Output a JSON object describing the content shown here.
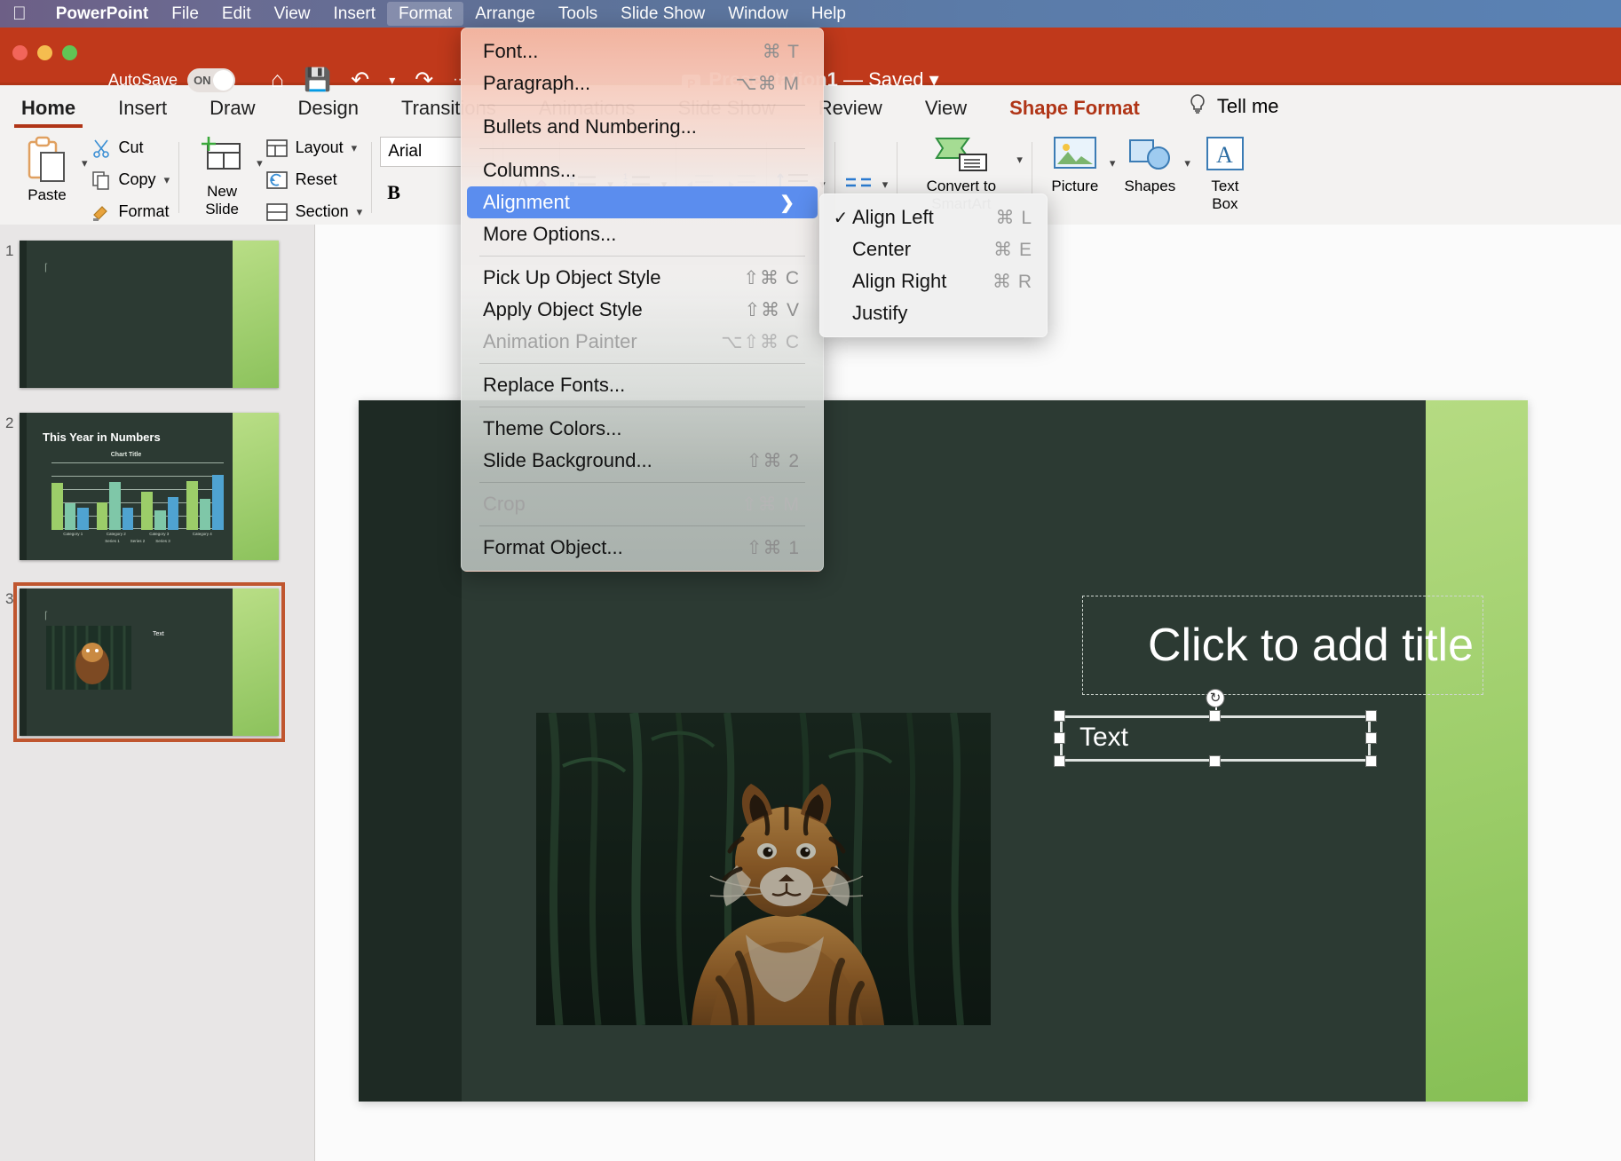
{
  "menubar": {
    "apple_icon": "apple-logo-icon",
    "app_name": "PowerPoint",
    "items": [
      "File",
      "Edit",
      "View",
      "Insert",
      "Format",
      "Arrange",
      "Tools",
      "Slide Show",
      "Window",
      "Help"
    ],
    "active_item": "Format"
  },
  "titlebar": {
    "autosave_label": "AutoSave",
    "autosave_state": "ON",
    "home_icon": "home-icon",
    "save_icon": "save-icon",
    "undo_icon": "undo-icon",
    "redo_icon": "redo-icon",
    "more_icon": "more-ellipsis-icon",
    "doc_title": "Presentation1",
    "doc_status": "— Saved",
    "badge": "P"
  },
  "ribbon": {
    "tabs": [
      {
        "label": "Home",
        "selected": true
      },
      {
        "label": "Insert",
        "selected": false
      },
      {
        "label": "Draw",
        "selected": false
      },
      {
        "label": "Design",
        "selected": false
      },
      {
        "label": "Transitions",
        "selected": false
      },
      {
        "label": "Animations",
        "selected": false
      },
      {
        "label": "Slide Show",
        "selected": false
      },
      {
        "label": "Review",
        "selected": false
      },
      {
        "label": "View",
        "selected": false
      }
    ],
    "context_tab": "Shape Format",
    "tell_me": "Tell me",
    "tell_me_icon": "lightbulb-icon",
    "clipboard": {
      "paste": "Paste",
      "cut": "Cut",
      "copy": "Copy",
      "format": "Format"
    },
    "slides": {
      "new_slide": "New\nSlide",
      "new_slide_line1": "New",
      "new_slide_line2": "Slide",
      "layout": "Layout",
      "reset": "Reset",
      "section": "Section"
    },
    "font": {
      "family": "Arial",
      "bold": "B"
    },
    "paragraph": {
      "text_effects_icon": "text-effects-icon",
      "bullets_icon": "bullets-icon",
      "numbering_icon": "numbering-icon",
      "decrease_indent_icon": "decrease-indent-icon",
      "increase_indent_icon": "increase-indent-icon",
      "line_spacing_icon": "line-spacing-icon",
      "align_left_icon": "align-left-icon",
      "align_center_icon": "align-center-icon",
      "align_right_icon": "align-right-icon",
      "justify_icon": "justify-icon",
      "text_direction_icon": "text-direction-icon",
      "align_text_icon": "align-text-icon",
      "columns_icon": "columns-icon"
    },
    "smartart": {
      "convert_line1": "Convert to",
      "convert_line2": "SmartArt"
    },
    "insert": {
      "picture": "Picture",
      "shapes": "Shapes",
      "textbox_line1": "Text",
      "textbox_line2": "Box"
    }
  },
  "format_menu": {
    "items": [
      {
        "label": "Font...",
        "shortcut": "⌘ T",
        "kind": "normal"
      },
      {
        "label": "Paragraph...",
        "shortcut": "⌥⌘ M",
        "kind": "normal"
      },
      {
        "kind": "separator"
      },
      {
        "label": "Bullets and Numbering...",
        "shortcut": "",
        "kind": "normal"
      },
      {
        "kind": "separator"
      },
      {
        "label": "Columns...",
        "shortcut": "",
        "kind": "normal"
      },
      {
        "label": "Alignment",
        "shortcut": "",
        "kind": "highlight",
        "arrow": "›"
      },
      {
        "label": "More Options...",
        "shortcut": "",
        "kind": "normal"
      },
      {
        "kind": "separator"
      },
      {
        "label": "Pick Up Object Style",
        "shortcut": "⇧⌘ C",
        "kind": "normal"
      },
      {
        "label": "Apply Object Style",
        "shortcut": "⇧⌘ V",
        "kind": "normal"
      },
      {
        "label": "Animation Painter",
        "shortcut": "⌥⇧⌘ C",
        "kind": "disabled"
      },
      {
        "kind": "separator"
      },
      {
        "label": "Replace Fonts...",
        "shortcut": "",
        "kind": "normal"
      },
      {
        "kind": "separator"
      },
      {
        "label": "Theme Colors...",
        "shortcut": "",
        "kind": "normal"
      },
      {
        "label": "Slide Background...",
        "shortcut": "⇧⌘ 2",
        "kind": "normal"
      },
      {
        "kind": "separator"
      },
      {
        "label": "Crop",
        "shortcut": "⇧⌘ M",
        "kind": "disabled"
      },
      {
        "kind": "separator"
      },
      {
        "label": "Format Object...",
        "shortcut": "⇧⌘ 1",
        "kind": "normal"
      }
    ]
  },
  "alignment_submenu": {
    "items": [
      {
        "label": "Align Left",
        "shortcut": "⌘ L",
        "checked": true
      },
      {
        "label": "Center",
        "shortcut": "⌘ E",
        "checked": false
      },
      {
        "label": "Align Right",
        "shortcut": "⌘ R",
        "checked": false
      },
      {
        "label": "Justify",
        "shortcut": "",
        "checked": false
      }
    ]
  },
  "thumbnails": [
    {
      "number": "1",
      "title": "",
      "selected": false
    },
    {
      "number": "2",
      "title": "This Year in Numbers",
      "chart_title": "Chart Title",
      "selected": false
    },
    {
      "number": "3",
      "title": "",
      "text_label": "Text",
      "selected": true
    }
  ],
  "slide": {
    "title_placeholder": "Click to add title",
    "textbox_value": "Text",
    "photo_alt": "tiger-photo"
  },
  "chart_data": {
    "type": "bar",
    "title": "Chart Title",
    "slide_title": "This Year in Numbers",
    "categories": [
      "Category 1",
      "Category 2",
      "Category 3",
      "Category 4"
    ],
    "series": [
      {
        "name": "Series 1",
        "values": [
          4.3,
          2.5,
          3.5,
          4.5
        ],
        "color": "#9ccd69"
      },
      {
        "name": "Series 2",
        "values": [
          2.4,
          4.4,
          1.8,
          2.8
        ],
        "color": "#7fc7a8"
      },
      {
        "name": "Series 3",
        "values": [
          2.0,
          2.0,
          3.0,
          5.0
        ],
        "color": "#4fa3d1"
      }
    ],
    "ylim": [
      0,
      6
    ],
    "grid": true,
    "legend": "bottom",
    "xlabel": "",
    "ylabel": ""
  }
}
